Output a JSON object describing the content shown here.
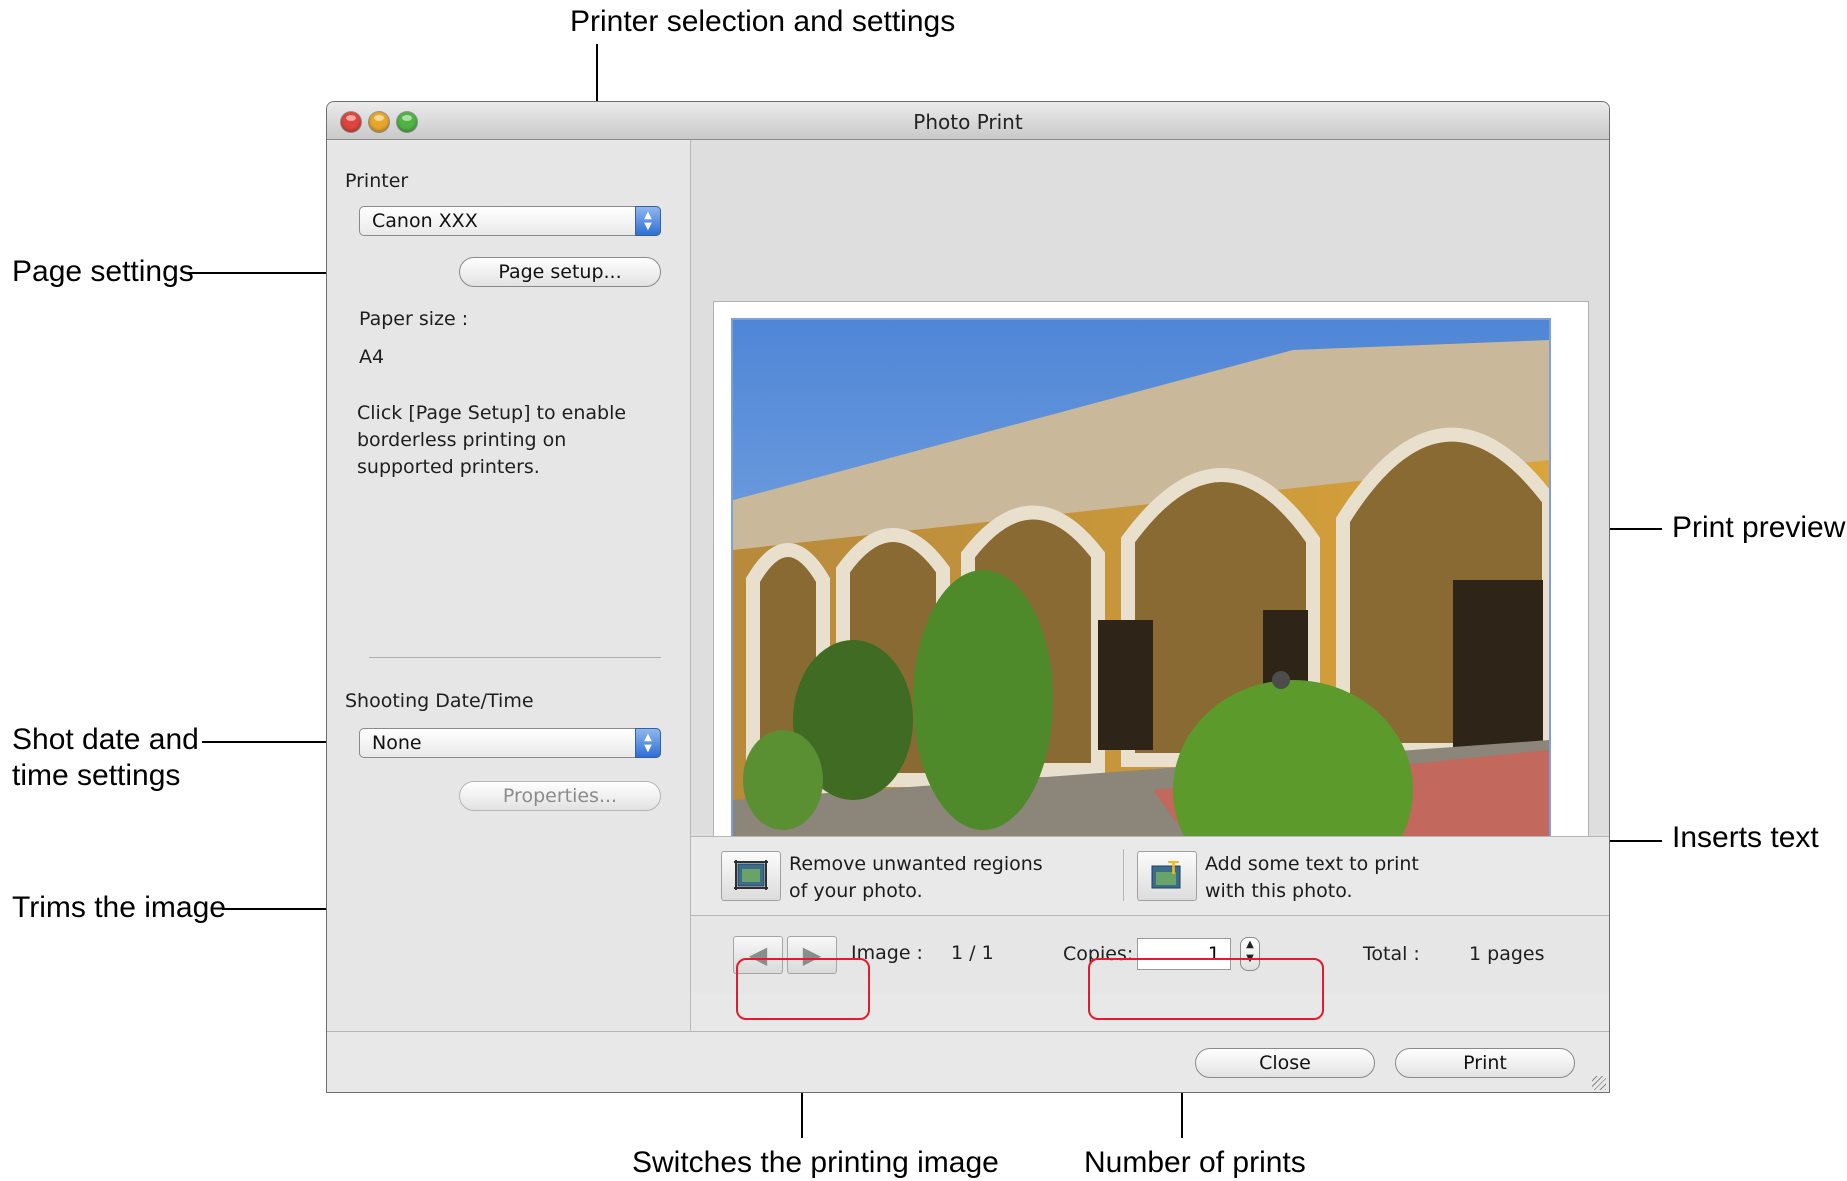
{
  "callouts": {
    "printer_selection": "Printer selection and settings",
    "page_settings": "Page settings",
    "shot_date_1": "Shot date and",
    "shot_date_2": "time settings",
    "trims": "Trims the image",
    "print_preview": "Print preview",
    "inserts_text": "Inserts text",
    "switches": "Switches the printing image",
    "number_prints": "Number of prints"
  },
  "window": {
    "title": "Photo Print"
  },
  "sidebar": {
    "printer_label": "Printer",
    "printer_value": "Canon XXX",
    "page_setup_button": "Page setup...",
    "paper_size_label": "Paper size :",
    "paper_size_value": "A4",
    "hint_line1": "Click [Page Setup] to enable",
    "hint_line2": "borderless printing on",
    "hint_line3": "supported printers.",
    "shooting_label": "Shooting Date/Time",
    "shooting_value": "None",
    "properties_button": "Properties..."
  },
  "tools": {
    "trim_line1": "Remove unwanted regions",
    "trim_line2": "of your photo.",
    "text_line1": "Add some text to print",
    "text_line2": "with this photo."
  },
  "nav": {
    "image_label": "Image :",
    "image_value": "1 / 1",
    "copies_label": "Copies:",
    "copies_value": "1",
    "total_label": "Total :",
    "total_value": "1 pages"
  },
  "buttons": {
    "close": "Close",
    "print": "Print"
  },
  "colors": {
    "highlight": "#e8192c",
    "popup_arrow": "#2d6fd6"
  },
  "icons": {
    "prev": "left-triangle-icon",
    "next": "right-triangle-icon",
    "trim": "trim-icon",
    "text": "insert-text-icon"
  }
}
